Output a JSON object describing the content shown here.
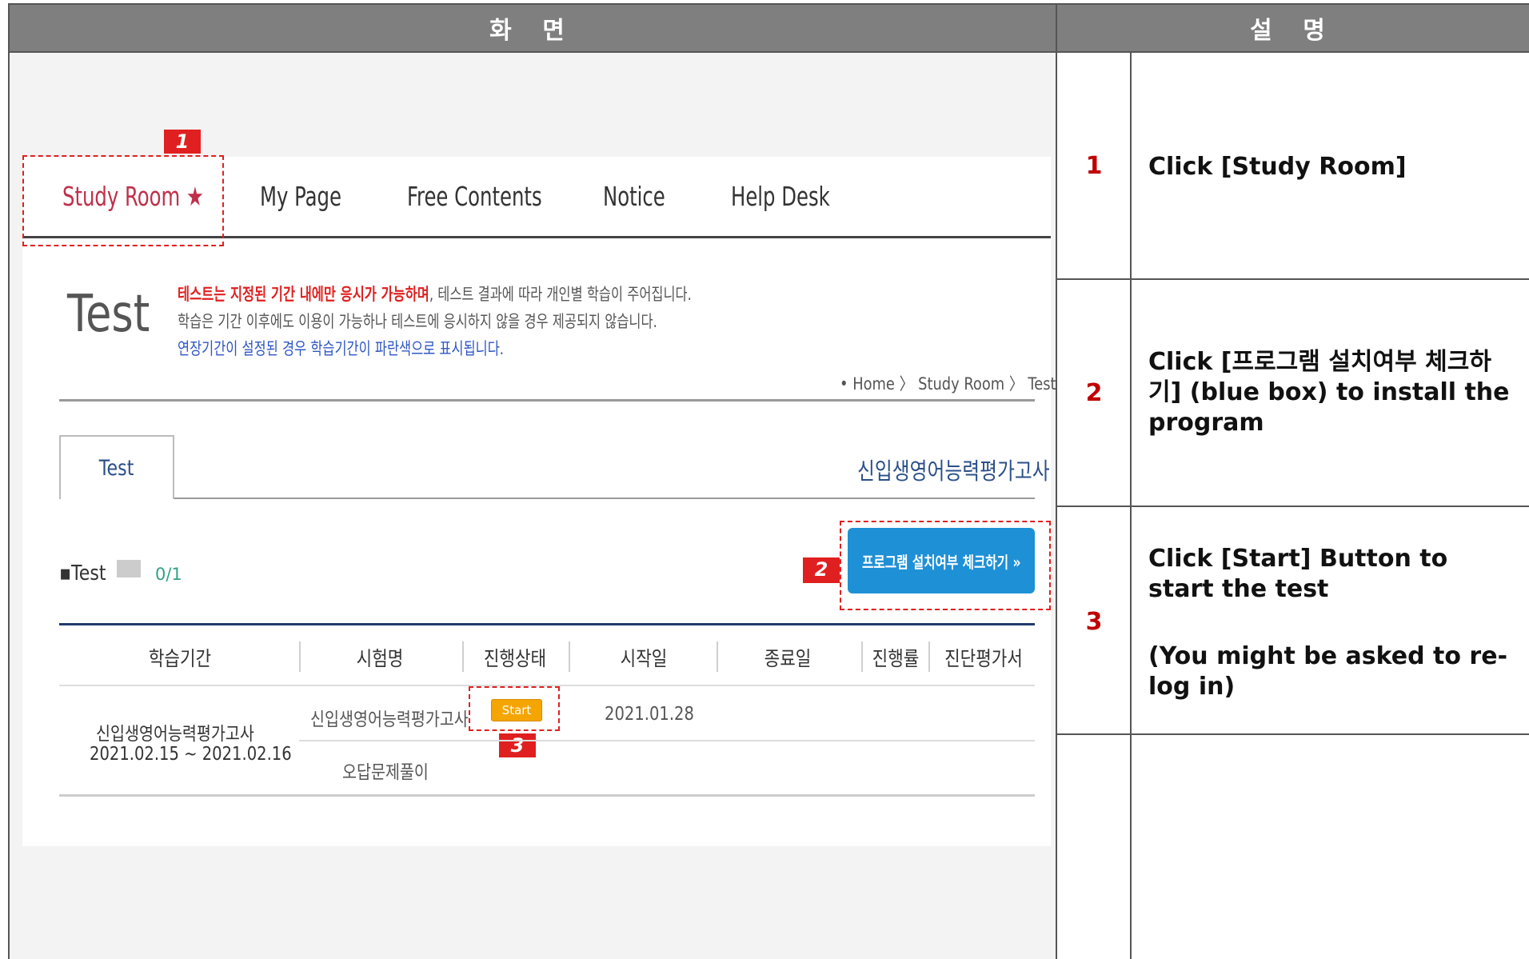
{
  "headers": {
    "screen": "화 면",
    "description": "설 명"
  },
  "menu": {
    "items": [
      "Study Room",
      "My Page",
      "Free Contents",
      "Notice",
      "Help Desk"
    ],
    "active_star": "★"
  },
  "page": {
    "title": "Test",
    "notice_line1_red": "테스트는 지정된 기간 내에만 응시가 가능하며",
    "notice_line1_rest": ", 테스트 결과에 따라 개인별 학습이 주어집니다.",
    "notice_line2": "학습은 기간 이후에도 이용이 가능하나 테스트에 응시하지 않을 경우 제공되지 않습니다.",
    "notice_line3": "연장기간이 설정된 경우 학습기간이 파란색으로 표시됩니다.",
    "breadcrumb": "• Home 〉 Study Room 〉 Test"
  },
  "tabs": {
    "active": "Test",
    "course_name": "신입생영어능력평가고사"
  },
  "summary": {
    "label": "Test",
    "count": "0/1"
  },
  "install_button": "프로그램 설치여부 체크하기 »",
  "table": {
    "headers": [
      "학습기간",
      "시험명",
      "진행상태",
      "시작일",
      "종료일",
      "진행률",
      "진단평가서"
    ],
    "period_name": "신입생영어능력평가고사",
    "period_dates": "2021.02.15 ~ 2021.02.16",
    "rows": [
      {
        "exam": "신입생영어능력평가고사",
        "status": "Start",
        "start": "2021.01.28"
      },
      {
        "exam": "오답문제풀이"
      }
    ]
  },
  "markers": [
    "1",
    "2",
    "3"
  ],
  "steps": [
    {
      "num": "1",
      "text": "Click [Study Room]"
    },
    {
      "num": "2",
      "text": "Click [프로그램 설치여부 체크하기] (blue box) to install the program"
    },
    {
      "num": "3",
      "text": "Click [Start] Button to start the test",
      "note": "(You might be asked to re-log in)"
    }
  ],
  "colors": {
    "header_bg": "#7f7f7f",
    "accent_red": "#e02020",
    "step_num": "#c00000",
    "button_blue": "#1e90d6",
    "start_orange": "#f5a500",
    "notice_blue": "#2f56c4"
  }
}
